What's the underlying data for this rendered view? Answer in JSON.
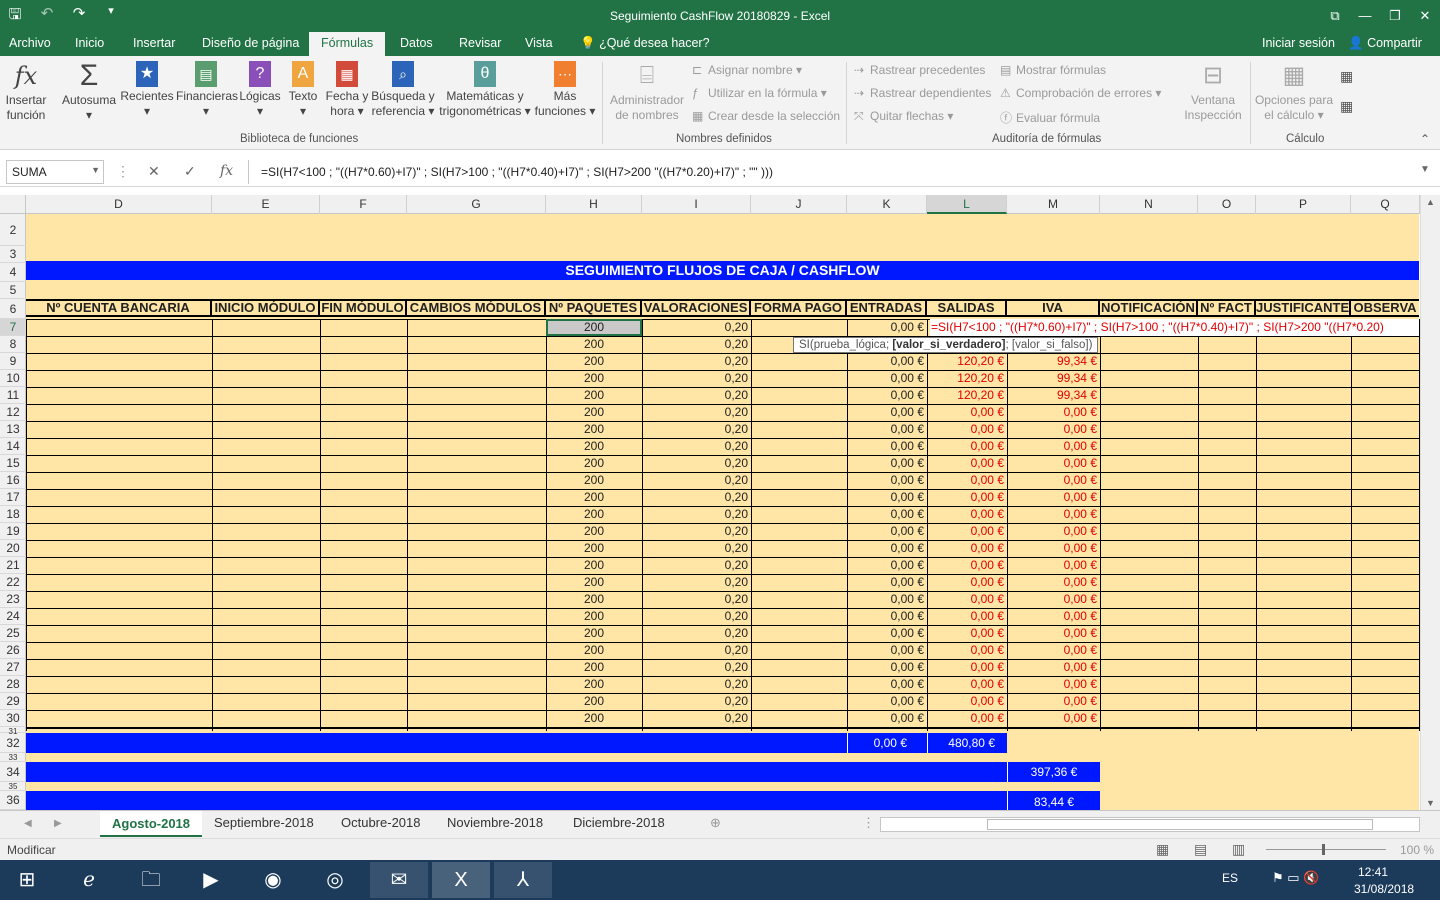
{
  "window": {
    "title": "Seguimiento CashFlow 20180829 - Excel"
  },
  "menu": {
    "tabs": [
      "Archivo",
      "Inicio",
      "Insertar",
      "Diseño de página",
      "Fórmulas",
      "Datos",
      "Revisar",
      "Vista"
    ],
    "active_tab": "Fórmulas",
    "tell_me": "¿Qué desea hacer?",
    "signin": "Iniciar sesión",
    "share": "Compartir"
  },
  "ribbon": {
    "insert_fn": [
      "Insertar",
      "función"
    ],
    "autosum": "Autosuma",
    "recent": "Recientes",
    "financial": "Financieras",
    "logical": "Lógicas",
    "text": "Texto",
    "datetime": [
      "Fecha y",
      "hora"
    ],
    "lookup": [
      "Búsqueda y",
      "referencia"
    ],
    "math": [
      "Matemáticas y",
      "trigonométricas"
    ],
    "more": [
      "Más",
      "funciones"
    ],
    "group_library": "Biblioteca de funciones",
    "name_manager": [
      "Administrador",
      "de nombres"
    ],
    "define_name": "Asignar nombre",
    "use_in_formula": "Utilizar en la fórmula",
    "create_from_sel": "Crear desde la selección",
    "group_names": "Nombres definidos",
    "trace_prec": "Rastrear precedentes",
    "trace_dep": "Rastrear dependientes",
    "remove_arrows": "Quitar flechas",
    "show_formulas": "Mostrar fórmulas",
    "error_check": "Comprobación de errores",
    "eval_formula": "Evaluar fórmula",
    "watch": [
      "Ventana",
      "Inspección"
    ],
    "group_audit": "Auditoría de fórmulas",
    "calc_options": [
      "Opciones para",
      "el cálculo"
    ],
    "group_calc": "Cálculo"
  },
  "formula_bar": {
    "name_box": "SUMA",
    "formula": "=SI(H7<100 ; \"((H7*0.60)+I7)\" ; SI(H7>100 ; \"((H7*0.40)+I7)\" ; SI(H7>200 \"((H7*0.20)+I7)\" ; \"\" )))"
  },
  "columns": [
    "D",
    "E",
    "F",
    "G",
    "H",
    "I",
    "J",
    "K",
    "L",
    "M",
    "N",
    "O",
    "P",
    "Q"
  ],
  "rows_visible": [
    "2",
    "3",
    "4",
    "5",
    "6",
    "7",
    "8",
    "9",
    "10",
    "11",
    "12",
    "13",
    "14",
    "15",
    "16",
    "17",
    "18",
    "19",
    "20",
    "21",
    "22",
    "23",
    "24",
    "25",
    "26",
    "27",
    "28",
    "29",
    "30",
    "31",
    "32",
    "33",
    "34",
    "35",
    "36"
  ],
  "sheet": {
    "title": "SEGUIMIENTO FLUJOS DE CAJA / CASHFLOW",
    "headers": [
      "Nº CUENTA BANCARIA",
      "INICIO MÓDULO",
      "FIN MÓDULO",
      "CAMBIOS MÓDULOS",
      "Nº PAQUETES",
      "VALORACIONES",
      "FORMA PAGO",
      "ENTRADAS",
      "SALIDAS",
      "IVA",
      "NOTIFICACIÓN",
      "Nº FACT",
      "JUSTIFICANTE",
      "OBSERVA"
    ],
    "paquetes": "200",
    "valoracion": "0,20",
    "entradas": "0,00 €",
    "salida_active": "120,20 €",
    "iva_active": "99,34 €",
    "zero": "0,00 €",
    "editing_formula": "=SI(H7<100 ; \"((H7*0.60)+I7)\" ; SI(H7>100 ; \"((H7*0.40)+I7)\" ; SI(H7>200 \"((H7*0.20)",
    "tooltip": [
      "SI(prueba_lógica; ",
      "[valor_si_verdadero]",
      "; [valor_si_falso])"
    ],
    "total_entradas": "0,00 €",
    "total_salidas": "480,80 €",
    "total_iva_base": "397,36 €",
    "total_iva": "83,44 €"
  },
  "sheet_tabs": [
    "Agosto-2018",
    "Septiembre-2018",
    "Octubre-2018",
    "Noviembre-2018",
    "Diciembre-2018"
  ],
  "status": {
    "mode": "Modificar",
    "zoom": "100 %"
  },
  "taskbar": {
    "lang": "ES",
    "time": "12:41",
    "date": "31/08/2018"
  }
}
